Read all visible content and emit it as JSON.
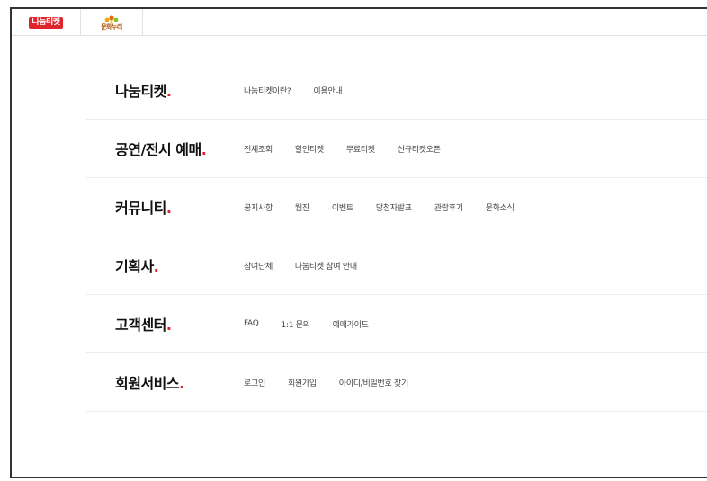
{
  "topbar": {
    "logo1_text": "나눔티켓",
    "logo2_text": "문화누리"
  },
  "menu": {
    "title_dot": ".",
    "rows": [
      {
        "title": "나눔티켓",
        "links": [
          "나눔티켓이란?",
          "이용안내"
        ]
      },
      {
        "title": "공연/전시 예매",
        "links": [
          "전체조회",
          "할인티켓",
          "무료티켓",
          "신규티켓오픈"
        ]
      },
      {
        "title": "커뮤니티",
        "links": [
          "공지사항",
          "웹진",
          "이벤트",
          "당첨자발표",
          "관람후기",
          "문화소식"
        ]
      },
      {
        "title": "기획사",
        "links": [
          "참여단체",
          "나눔티켓 참여 안내"
        ]
      },
      {
        "title": "고객센터",
        "links": [
          "FAQ",
          "1:1 문의",
          "예매가이드"
        ]
      },
      {
        "title": "회원서비스",
        "links": [
          "로그인",
          "회원가입",
          "아이디/비밀번호 찾기"
        ]
      }
    ]
  },
  "colors": {
    "accent": "#e0242b",
    "border": "#333333"
  }
}
